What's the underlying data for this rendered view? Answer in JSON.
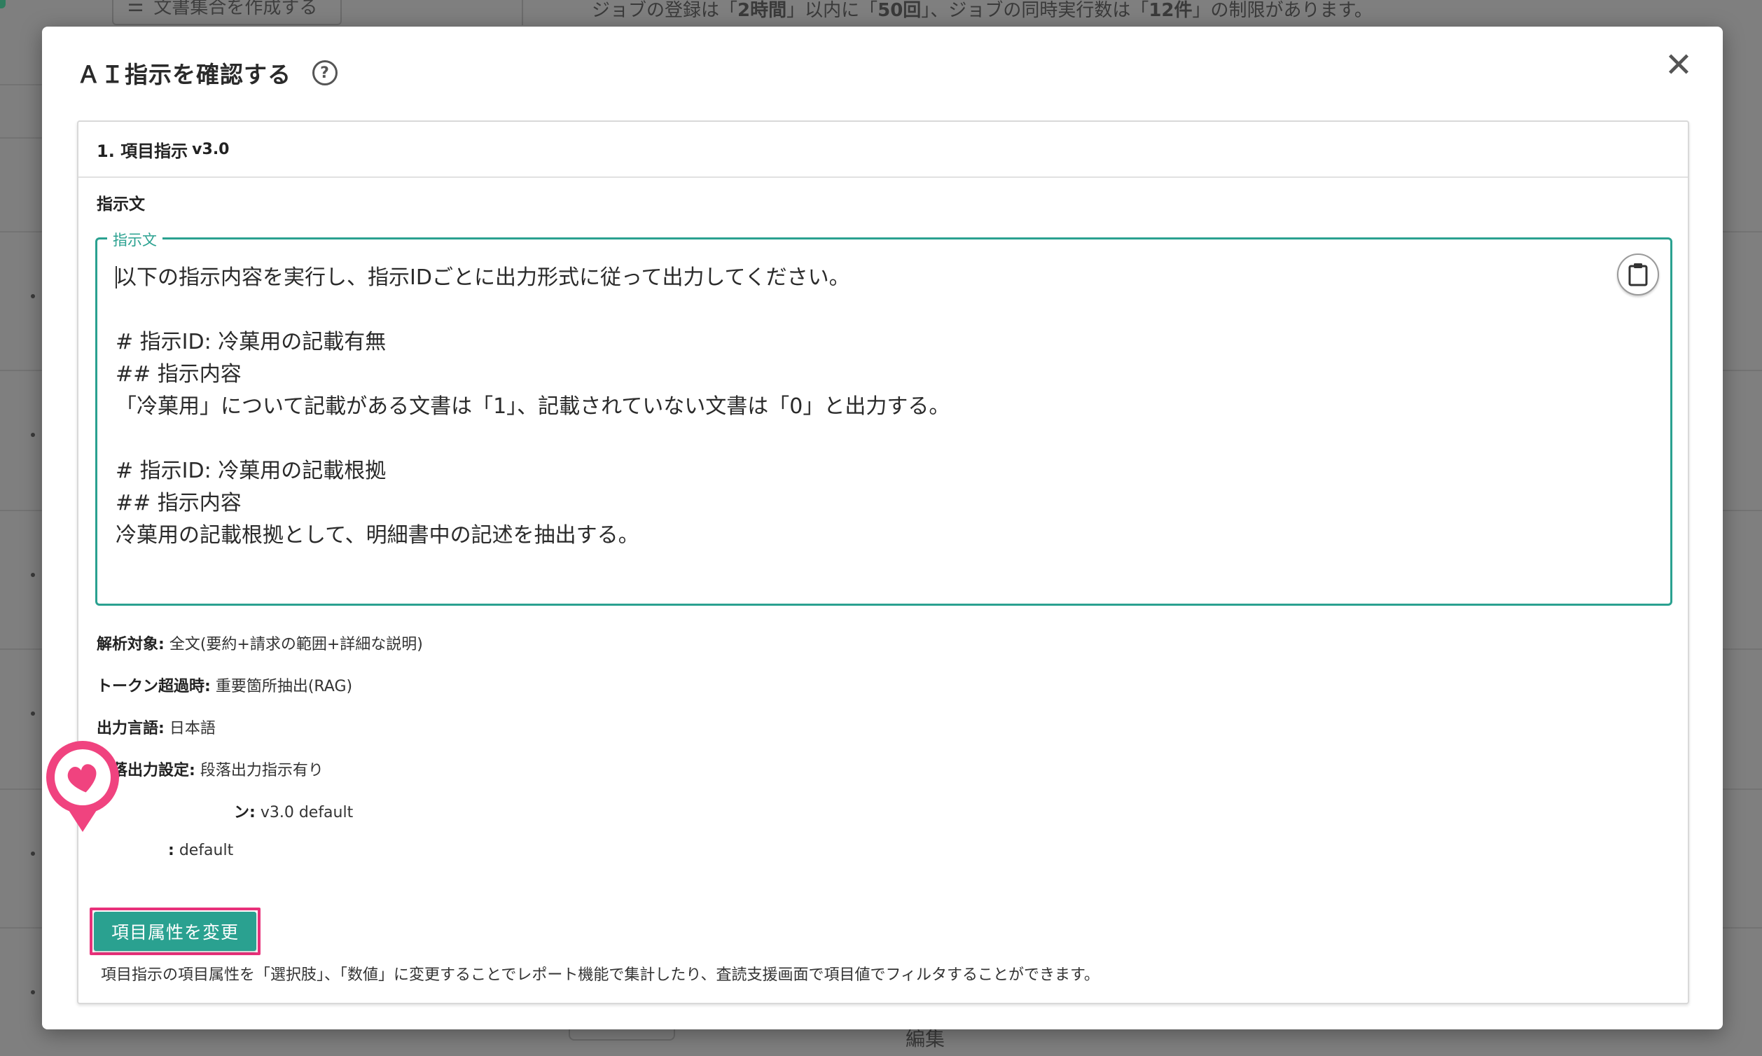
{
  "background": {
    "top_button_label": "文書集合を作成する",
    "notice_parts": [
      "ジョブの登録は「",
      "2時間",
      "」以内に「",
      "50回",
      "」、ジョブの同時実行数は「",
      "12件",
      "」の制限があります。"
    ],
    "bottom_label": "編集"
  },
  "modal": {
    "title": "ＡＩ指示を確認する",
    "card": {
      "header_title": "1. 項目指示",
      "header_version": "v3.0",
      "section_label": "指示文",
      "textarea_legend": "指示文",
      "instruction_text": "以下の指示内容を実行し、指示IDごとに出力形式に従って出力してください。\n\n# 指示ID: 冷菓用の記載有無\n## 指示内容\n「冷菓用」について記載がある文書は「1」、記載されていない文書は「0」と出力する。\n\n# 指示ID: 冷菓用の記載根拠\n## 指示内容\n冷菓用の記載根拠として、明細書中の記述を抽出する。",
      "attributes": [
        {
          "label": "解析対象:",
          "value": "全文(要約+請求の範囲+詳細な説明)"
        },
        {
          "label": "トークン超過時:",
          "value": "重要箇所抽出(RAG)"
        },
        {
          "label": "出力言語:",
          "value": "日本語"
        },
        {
          "label": "段落出力設定:",
          "value": "段落出力指示有り"
        },
        {
          "label": "ン:",
          "value": "v3.0 default"
        },
        {
          "label": ":",
          "value": "default"
        }
      ],
      "change_button_label": "項目属性を変更",
      "helper_text": "項目指示の項目属性を「選択肢」、「数値」に変更することでレポート機能で集計したり、査読支援画面で項目値でフィルタすることができます。"
    }
  },
  "colors": {
    "accent": "#2aa190",
    "highlight": "#e8317a",
    "marker": "#f0437f"
  }
}
